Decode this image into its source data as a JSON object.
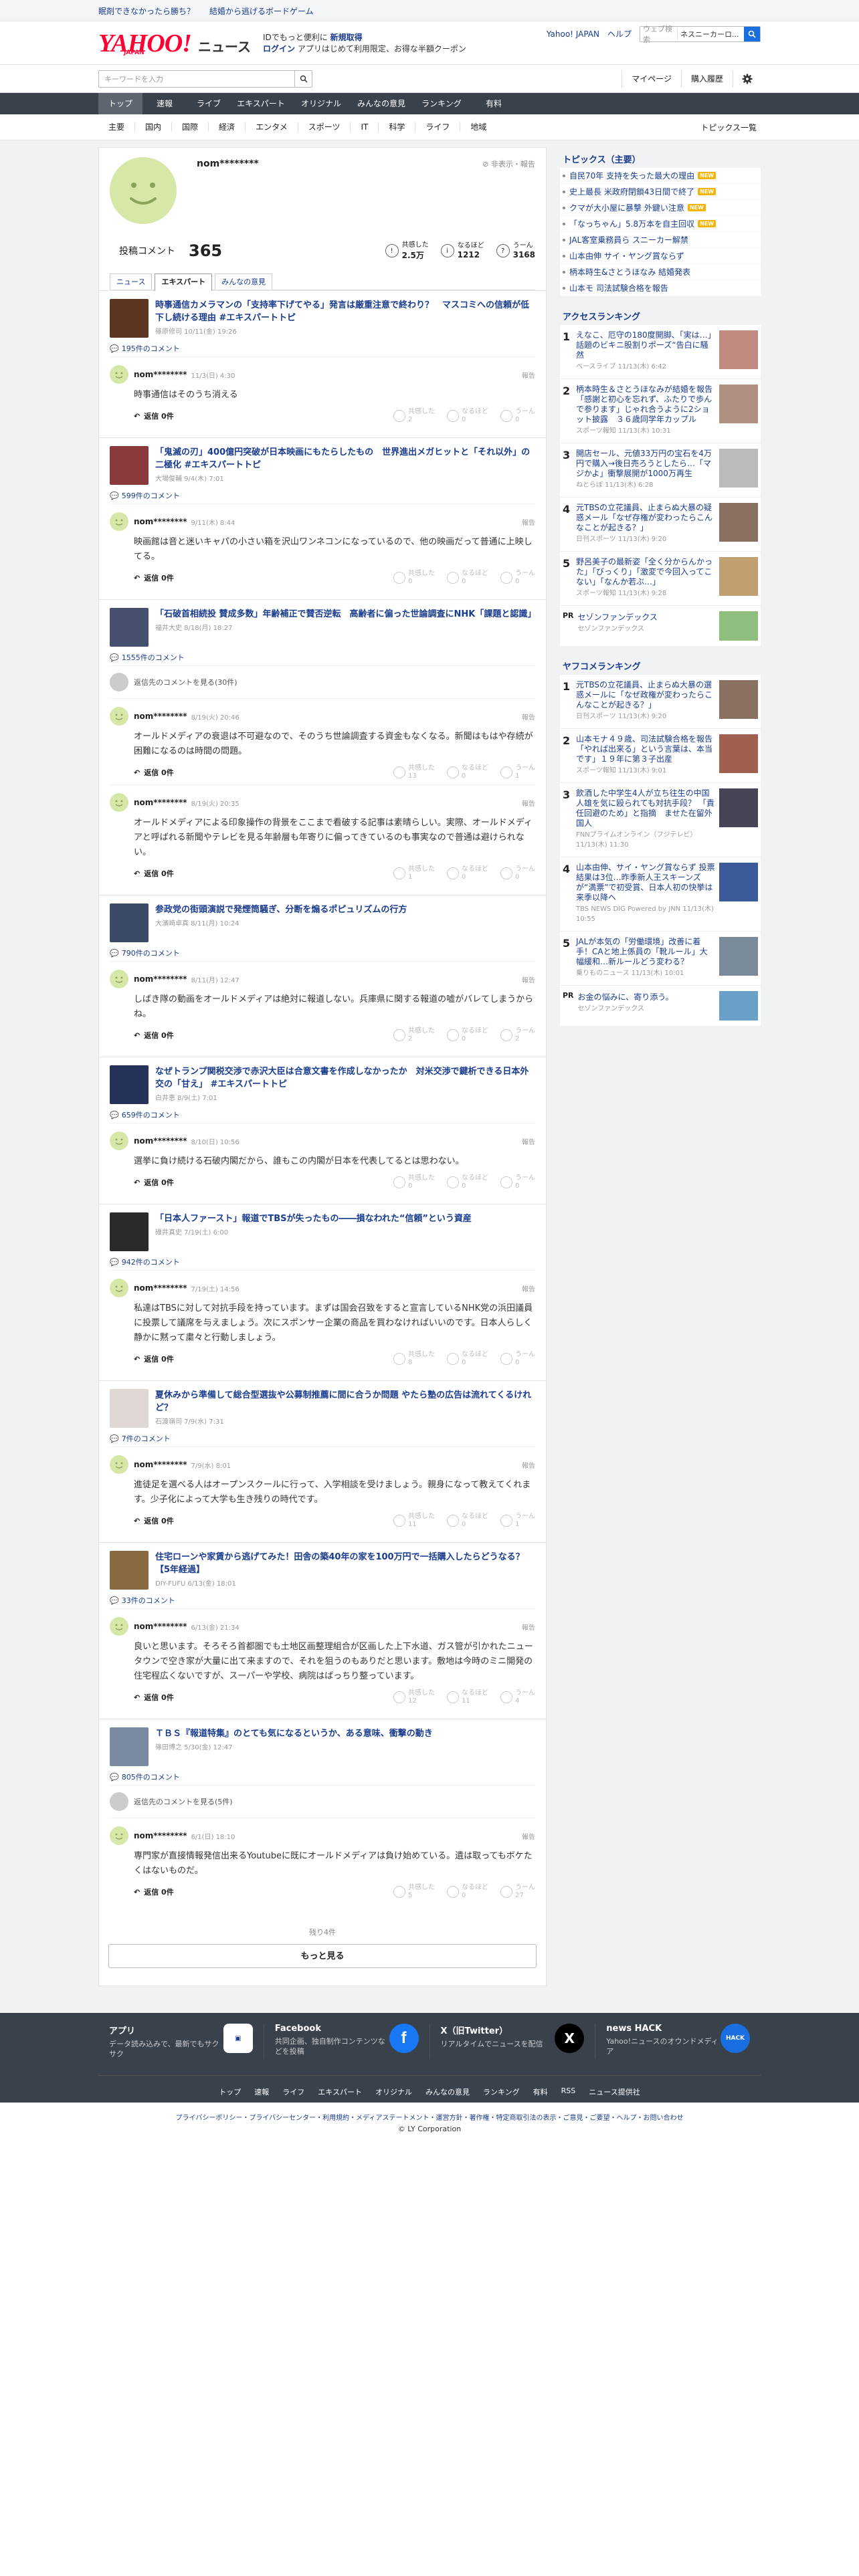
{
  "promo": {
    "links": [
      "眠剤できなかったら勝ち？",
      "結婚から逃げるボードゲーム"
    ]
  },
  "header": {
    "logo_text": "YAHOO!",
    "logo_sub": "JAPAN",
    "logo_news": "ニュース",
    "msg_line1_pre": "IDでもっと便利に",
    "msg_line1_link": "新規取得",
    "msg_line2_login": "ログイン",
    "msg_line2_rest": "アプリはじめて利用限定、お得な半額クーポン",
    "links": [
      "Yahoo! JAPAN",
      "ヘルプ"
    ],
    "search_placeholder": "ウェブ検索",
    "search_value": "ネスニーカーロ..."
  },
  "search_row": {
    "placeholder": "キーワードを入力",
    "mypage": "マイページ",
    "history": "購入履歴"
  },
  "global_nav": [
    "トップ",
    "速報",
    "ライブ",
    "エキスパート",
    "オリジナル",
    "みんなの意見",
    "ランキング",
    "有料"
  ],
  "sub_nav": {
    "items": [
      "主要",
      "国内",
      "国際",
      "経済",
      "エンタメ",
      "スポーツ",
      "IT",
      "科学",
      "ライフ",
      "地域"
    ],
    "right": "トピックス一覧"
  },
  "profile": {
    "name": "nom********",
    "flag": "非表示・報告",
    "comment_label": "投稿コメント",
    "comment_count": "365",
    "reactions": [
      {
        "label": "共感した",
        "value": "2.5万",
        "icon": "!"
      },
      {
        "label": "なるほど",
        "value": "1212",
        "icon": "i"
      },
      {
        "label": "うーん",
        "value": "3168",
        "icon": "?"
      }
    ],
    "tabs": [
      "ニュース",
      "エキスパート",
      "みんなの意見"
    ]
  },
  "blocks": [
    {
      "title": "時事通信カメラマンの「支持率下げてやる」発言は厳重注意で終わり？　マスコミへの信頼が低下し続ける理由 #エキスパートトピ",
      "meta": "篠原修司 10/11(金) 19:26",
      "count": "195件のコメント",
      "thumb": "#5a3520",
      "comments": [
        {
          "name": "nom********",
          "date": "11/3(日) 4:30",
          "text": "時事通信はそのうち消える",
          "reply": "返信 0件",
          "r": [
            "2",
            "0",
            "0"
          ]
        }
      ]
    },
    {
      "title": "「鬼滅の刃」400億円突破が日本映画にもたらしたもの　世界進出メガヒットと「それ以外」の二極化 #エキスパートトピ",
      "meta": "大場俊輔 9/4(木) 7:01",
      "count": "599件のコメント",
      "thumb": "#8a3a3a",
      "comments": [
        {
          "name": "nom********",
          "date": "9/11(木) 8:44",
          "text": "映画館は音と迷いキャパの小さい箱を沢山ワンネコンになっているので、他の映画だって普通に上映してる。",
          "reply": "返信 0件",
          "r": [
            "0",
            "0",
            "0"
          ]
        }
      ]
    },
    {
      "title": "「石破首相続投 賛成多数」年齢補正で賛否逆転　高齢者に偏った世論調査にNHK「課題と認識」",
      "meta": "福井大史 8/18(月) 18:27",
      "count": "1555件のコメント",
      "thumb": "#46506e",
      "deleted": "返信先のコメントを見る(30件)",
      "comments": [
        {
          "name": "nom********",
          "date": "8/19(火) 20:46",
          "text": "オールドメディアの衰退は不可避なので、そのうち世論調査する資金もなくなる。新聞はもはや存続が困難になるのは時間の問題。",
          "reply": "返信 0件",
          "r": [
            "13",
            "0",
            "1"
          ]
        },
        {
          "name": "nom********",
          "date": "8/19(火) 20:35",
          "text": "オールドメディアによる印象操作の背景をここまで看破する記事は素晴らしい。実際、オールドメディアと呼ばれる新聞やテレビを見る年齢層も年寄りに偏ってきているのも事実なので普通は避けられない。",
          "reply": "返信 0件",
          "r": [
            "1",
            "0",
            "0"
          ]
        }
      ]
    },
    {
      "title": "参政党の街頭演説で発煙筒騒ぎ、分断を煽るポピュリズムの行方",
      "meta": "大濱崎卓真 8/11(月) 10:24",
      "count": "790件のコメント",
      "thumb": "#3d4a66",
      "comments": [
        {
          "name": "nom********",
          "date": "8/11(月) 12:47",
          "text": "しばき隊の動画をオールドメディアは絶対に報道しない。兵庫県に関する報道の嘘がバレてしまうからね。",
          "reply": "返信 0件",
          "r": [
            "2",
            "0",
            "2"
          ]
        }
      ]
    },
    {
      "title": "なぜトランプ関税交渉で赤沢大臣は合意文書を作成しなかったか　対米交渉で鍵析できる日本外交の「甘え」 #エキスパートトピ",
      "meta": "白井恵 8/9(土) 7:01",
      "count": "659件のコメント",
      "thumb": "#27325a",
      "comments": [
        {
          "name": "nom********",
          "date": "8/10(日) 10:56",
          "text": "選挙に負け続ける石破内閣だから、誰もこの内閣が日本を代表してるとは思わない。",
          "reply": "返信 0件",
          "r": [
            "0",
            "0",
            "0"
          ]
        }
      ]
    },
    {
      "title": "「日本人ファースト」報道でTBSが失ったもの――損なわれた“信頼”という資産",
      "meta": "碓井真史 7/19(土) 6:00",
      "count": "942件のコメント",
      "thumb": "#2a2a2a",
      "comments": [
        {
          "name": "nom********",
          "date": "7/19(土) 14:56",
          "text": "私達はTBSに対して対抗手段を持っています。まずは国会召致をすると宣言しているNHK党の浜田議員に投票して議席を与えましょう。次にスポンサー企業の商品を買わなければいいのです。日本人らしく静かに黙って粛々と行動しましょう。",
          "reply": "返信 0件",
          "r": [
            "8",
            "0",
            "0"
          ]
        }
      ]
    },
    {
      "title": "夏休みから準備して総合型選抜や公募制推薦に間に合うか問題 やたら塾の広告は流れてくるけれど？",
      "meta": "石渡嶺司 7/9(水) 7:31",
      "count": "7件のコメント",
      "thumb": "#e0d8d4",
      "comments": [
        {
          "name": "nom********",
          "date": "7/9(水) 8:01",
          "text": "進徒足を選べる人はオープンスクールに行って、入学相談を受けましょう。親身になって教えてくれます。少子化によって大学も生き残りの時代です。",
          "reply": "返信 0件",
          "r": [
            "11",
            "0",
            "1"
          ]
        }
      ]
    },
    {
      "title": "住宅ローンや家賃から逃げてみた！田舎の築40年の家を100万円で一括購入したらどうなる？【5年経過】",
      "meta": "DIY-FUFU 6/13(金) 18:01",
      "count": "33件のコメント",
      "thumb": "#8a6a40",
      "comments": [
        {
          "name": "nom********",
          "date": "6/13(金) 21:34",
          "text": "良いと思います。そろそろ首都圏でも土地区画整理組合が区画した上下水道、ガス管が引かれたニュータウンで空き家が大量に出て来ますので、それを狙うのもありだと思います。敷地は今時のミニ開発の住宅程広くないですが、スーパーや学校、病院はばっちり整っています。",
          "reply": "返信 0件",
          "r": [
            "12",
            "11",
            "4"
          ]
        }
      ]
    },
    {
      "title": "ＴＢＳ『報道特集』のとても気になるというか、ある意味、衝撃の動き",
      "meta": "篠田博之 5/30(金) 12:47",
      "count": "805件のコメント",
      "thumb": "#7a8aa0",
      "deleted": "返信先のコメントを見る(5件)",
      "comments": [
        {
          "name": "nom********",
          "date": "6/1(日) 18:10",
          "text": "専門家が直接情報発信出来るYoutubeに既にオールドメディアは負け始めている。遺は取ってもボケたくはないものだ。",
          "reply": "返信 0件",
          "r": [
            "5",
            "0",
            "27"
          ]
        }
      ]
    }
  ],
  "reaction_labels": [
    "共感した",
    "なるほど",
    "うーん"
  ],
  "remain": "残り4件",
  "more": "もっと見る",
  "right": {
    "topics_title": "トピックス（主要）",
    "topics": [
      {
        "t": "自民70年 支持を失った最大の理由",
        "new": true
      },
      {
        "t": "史上最長 米政府閉鎖43日間で終了",
        "new": true
      },
      {
        "t": "クマが大小屋に暴撃 外鍵い注意",
        "new": true
      },
      {
        "t": "「なっちゃん」5.8万本を自主回収",
        "new": true
      },
      {
        "t": "JAL客室乗務員ら スニーカー解禁",
        "new": false
      },
      {
        "t": "山本由伸 サイ・ヤング賞ならず",
        "new": false
      },
      {
        "t": "柄本時生&さとうほなみ 結婚発表",
        "new": false
      },
      {
        "t": "山本モ 司法試験合格を報告",
        "new": false
      }
    ],
    "new_label": "NEW",
    "access_title": "アクセスランキング",
    "access": [
      {
        "t": "えなこ、厄守の180度開脚、「実は…」話題のビキニ股割りポーズ“告白に騒然",
        "s": "ベースライブ 11/13(木) 6:42",
        "c": "#c08a80"
      },
      {
        "t": "柄本時生＆さとうほなみが結婚を報告「感謝と初心を忘れず、ふたりで歩んで参ります」じゃれ合うように2ショット披露　３６歳同学年カップル",
        "s": "スポーツ報知 11/13(木) 10:31",
        "c": "#b09080"
      },
      {
        "t": "開店セール、元値33万円の宝石を4万円で購入→後日売ろうとしたら…「マジかよ」衝撃展開が1000万再生",
        "s": "ねとらぼ 11/13(木) 6:28",
        "c": "#bbb"
      },
      {
        "t": "元TBSの立花議員、止まらぬ大暴の疑惑メール「なぜ存権が変わったらこんなことが起きる？」",
        "s": "日刊スポーツ 11/13(木) 9:20",
        "c": "#8a7060"
      },
      {
        "t": "野呂美子の最新姿「全く分からんかった」「びっくり」「激変で今回入ってこない」「なんか若ぶ…」",
        "s": "スポーツ報知 11/13(木) 9:28",
        "c": "#c0a070"
      }
    ],
    "pr1": {
      "tag": "PR",
      "t": "セゾンファンデックス",
      "s": "セゾンファンデックス"
    },
    "yahoo_title": "ヤフコメランキング",
    "yahoo": [
      {
        "t": "元TBSの立花議員、止まらぬ大暴の選惑メールに「なぜ政権が変わったらこんなことが起きる？」",
        "s": "日刊スポーツ 11/13(木) 9:20",
        "c": "#8a7060"
      },
      {
        "t": "山本モナ４９歳、司法試験合格を報告「やれば出来る」という言葉は、本当です」１９年に第３子出産",
        "s": "スポーツ報知 11/13(木) 9:01",
        "c": "#a06050"
      },
      {
        "t": "飲酒した中学生4人が立ち往生の中国人雄を気に殴られても対抗手段？ 「責任回避のため」と指摘　ませた在留外国人",
        "s": "FNNプライムオンライン（フジテレビ） 11/13(木) 11:30",
        "c": "#445"
      },
      {
        "t": "山本由伸、サイ・ヤング賞ならず 投票結果は3位…昨季新人王スキーンズが“満票”で初受賞、日本人初の快挙は来季以降へ",
        "s": "TBS NEWS DIG Powered by JNN 11/13(木) 10:55",
        "c": "#3a5a9a"
      },
      {
        "t": "JALが本気の「労働環境」改善に着手！CAと地上係員の「靴ルール」大幅緩和…新ルールどう変わる？",
        "s": "乗りものニュース 11/13(木) 10:01",
        "c": "#7a8a9a"
      }
    ],
    "pr2": {
      "tag": "PR",
      "t": "お金の悩みに、寄り添う。",
      "s": "セゾンファンデックス"
    }
  },
  "footer": {
    "cols": [
      {
        "t": "アプリ",
        "d": "データ読み込みで、最新でもサクサク",
        "ic": "app"
      },
      {
        "t": "Facebook",
        "d": "共同企画、独自制作コンテンツなどを投稿",
        "ic": "f"
      },
      {
        "t": "X（旧Twitter）",
        "d": "リアルタイムでニュースを配信",
        "ic": "X"
      },
      {
        "t": "news HACK",
        "d": "Yahoo!ニュースのオウンドメディア",
        "ic": "HACK"
      }
    ],
    "nav": [
      "トップ",
      "速報",
      "ライフ",
      "エキスパート",
      "オリジナル",
      "みんなの意見",
      "ランキング",
      "有料",
      "RSS",
      "ニュース提供社"
    ],
    "legal": "プライバシーポリシー・プライバシーセンター・利用規約・メディアステートメント・運営方針・著作権・特定商取引法の表示・ご意見・ご要望・ヘルプ・お問い合わせ",
    "copy": "© LY Corporation"
  }
}
